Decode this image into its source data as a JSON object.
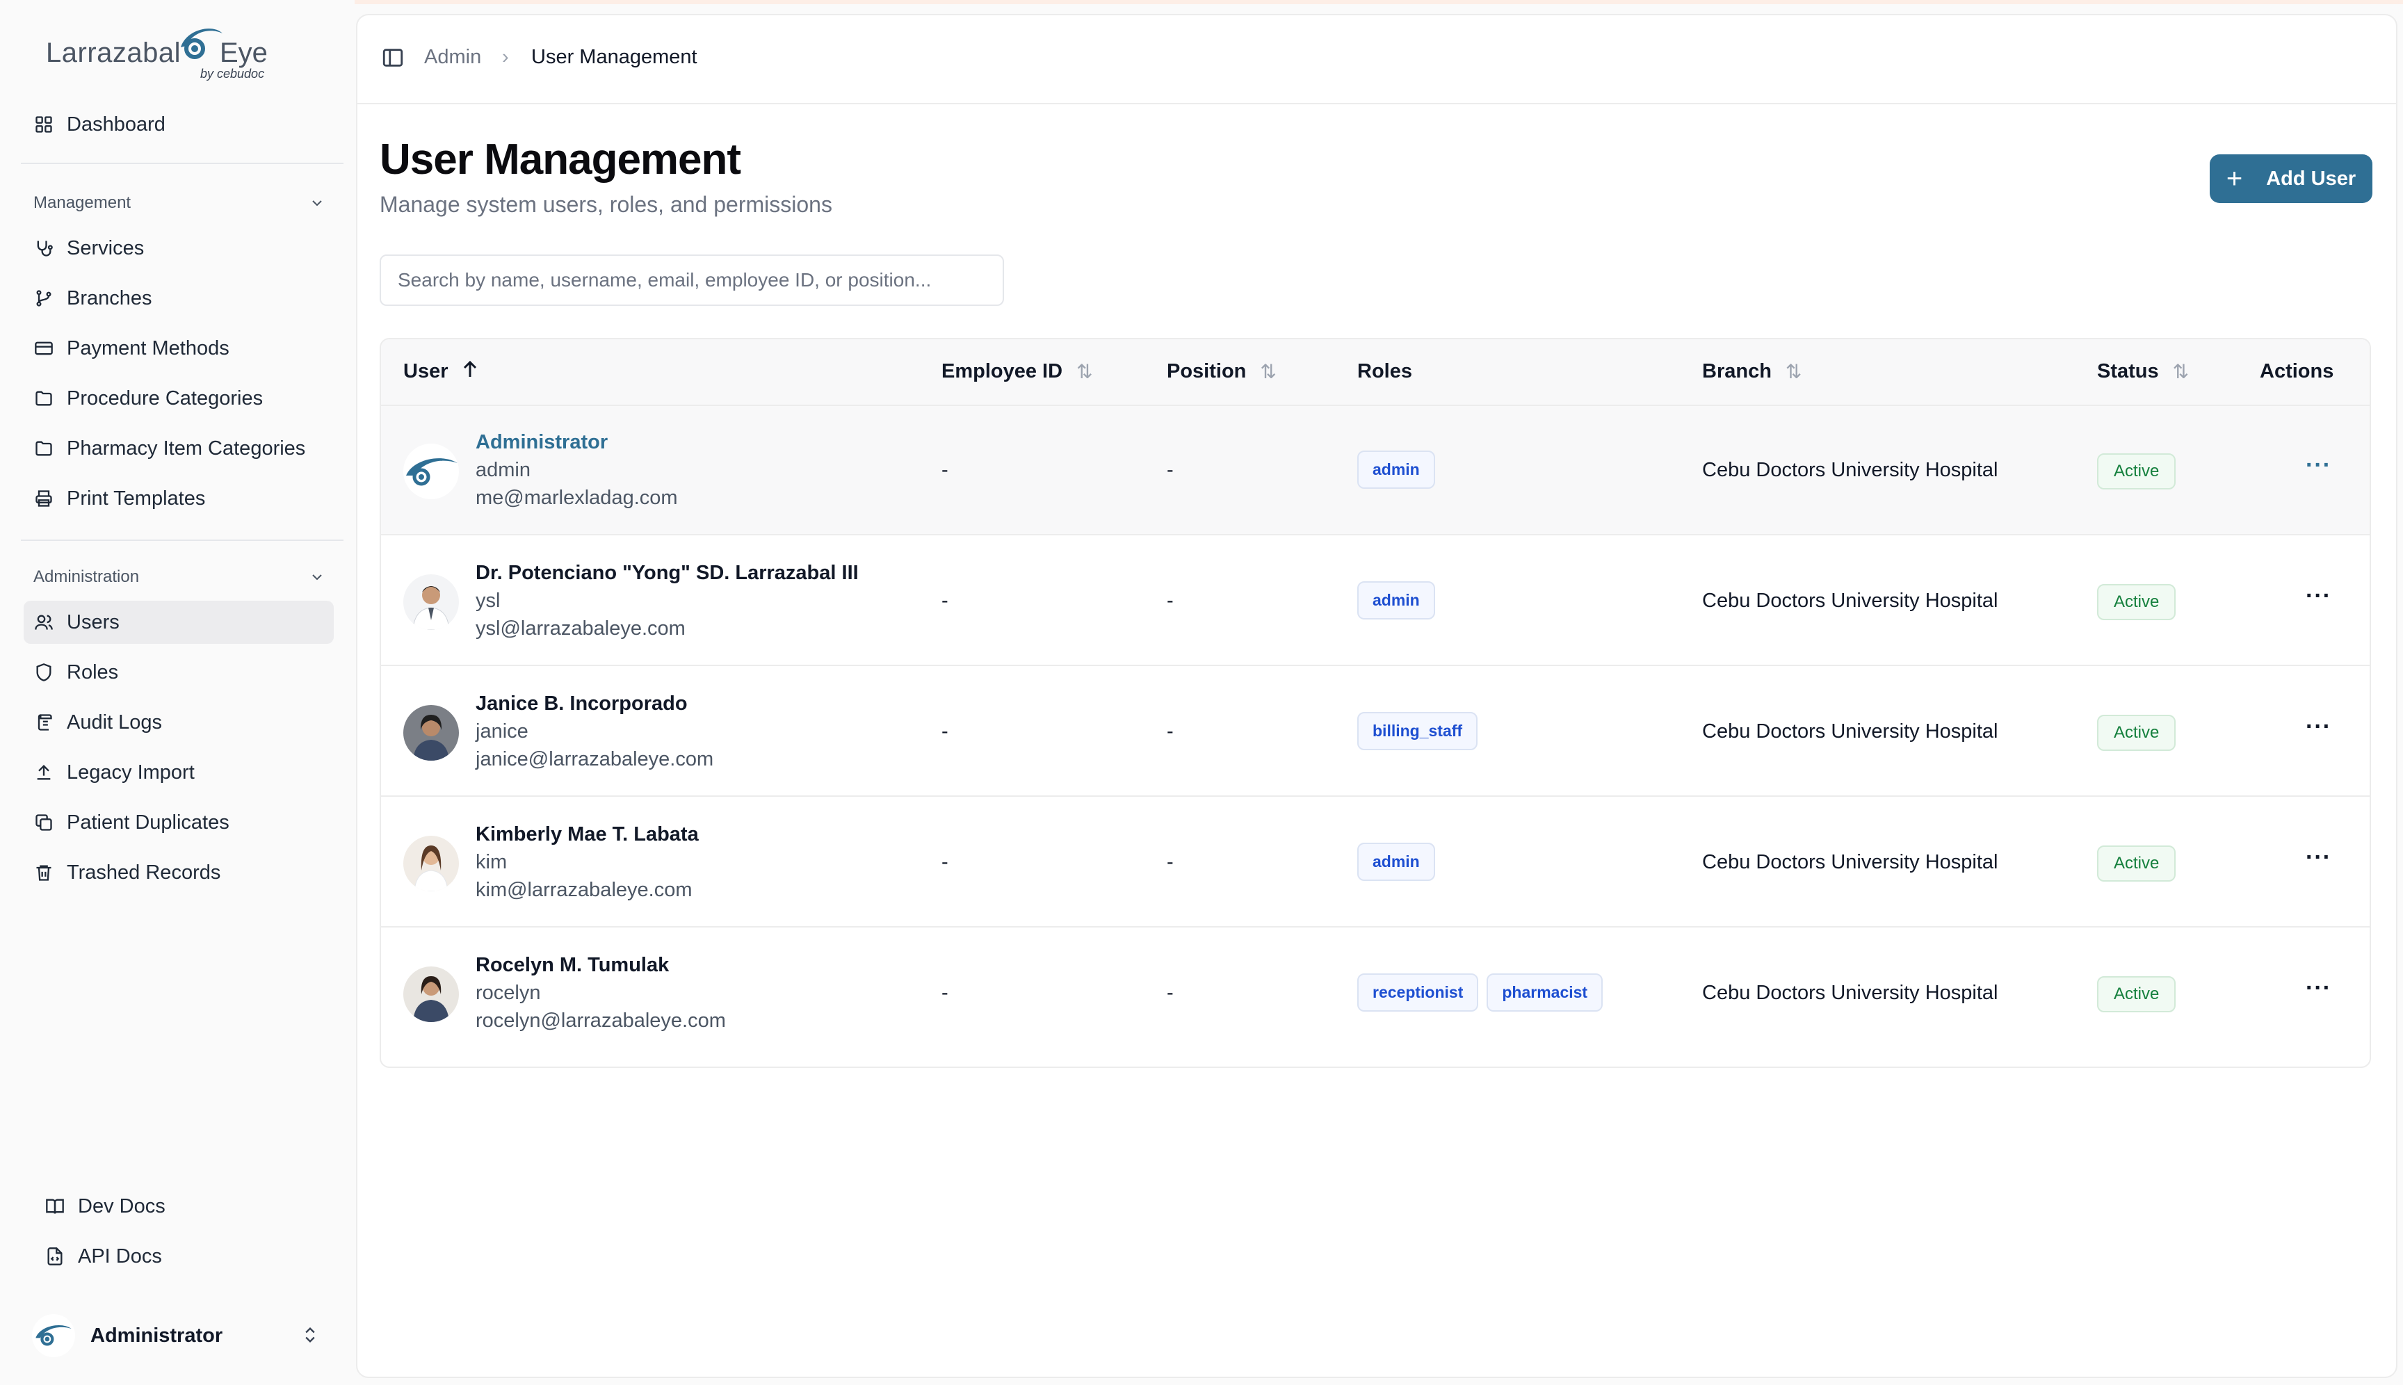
{
  "brand": {
    "name_left": "Larrazabal",
    "name_right": "Eye",
    "subtitle": "by cebudoc",
    "accent_color": "#2f6f94"
  },
  "sidebar": {
    "top_item": {
      "label": "Dashboard",
      "icon": "dashboard-grid-icon"
    },
    "sections": [
      {
        "label": "Management",
        "items": [
          {
            "label": "Services",
            "icon": "stethoscope-icon"
          },
          {
            "label": "Branches",
            "icon": "git-branch-icon"
          },
          {
            "label": "Payment Methods",
            "icon": "credit-card-icon"
          },
          {
            "label": "Procedure Categories",
            "icon": "folder-icon"
          },
          {
            "label": "Pharmacy Item Categories",
            "icon": "folder-icon"
          },
          {
            "label": "Print Templates",
            "icon": "printer-icon"
          }
        ]
      },
      {
        "label": "Administration",
        "items": [
          {
            "label": "Users",
            "icon": "users-icon",
            "active": true
          },
          {
            "label": "Roles",
            "icon": "shield-icon"
          },
          {
            "label": "Audit Logs",
            "icon": "scroll-icon"
          },
          {
            "label": "Legacy Import",
            "icon": "upload-icon"
          },
          {
            "label": "Patient Duplicates",
            "icon": "copy-icon"
          },
          {
            "label": "Trashed Records",
            "icon": "trash-icon"
          }
        ]
      }
    ],
    "footer_links": [
      {
        "label": "Dev Docs",
        "icon": "book-icon"
      },
      {
        "label": "API Docs",
        "icon": "file-code-icon"
      }
    ],
    "current_user": "Administrator"
  },
  "breadcrumb": {
    "parent": "Admin",
    "separator": "›",
    "current": "User Management"
  },
  "page": {
    "title": "User Management",
    "subtitle": "Manage system users, roles, and permissions",
    "add_button": "Add User",
    "search_placeholder": "Search by name, username, email, employee ID, or position..."
  },
  "table": {
    "headers": {
      "user": "User",
      "employee_id": "Employee ID",
      "position": "Position",
      "roles": "Roles",
      "branch": "Branch",
      "status": "Status",
      "actions": "Actions"
    },
    "rows": [
      {
        "name": "Administrator",
        "username": "admin",
        "email": "me@marlexladag.com",
        "employee_id": "-",
        "position": "-",
        "roles": [
          "admin"
        ],
        "branch": "Cebu Doctors University Hospital",
        "status": "Active",
        "actions": "···"
      },
      {
        "name": "Dr. Potenciano \"Yong\" SD. Larrazabal III",
        "username": "ysl",
        "email": "ysl@larrazabaleye.com",
        "employee_id": "-",
        "position": "-",
        "roles": [
          "admin"
        ],
        "branch": "Cebu Doctors University Hospital",
        "status": "Active",
        "actions": "···"
      },
      {
        "name": "Janice B. Incorporado",
        "username": "janice",
        "email": "janice@larrazabaleye.com",
        "employee_id": "-",
        "position": "-",
        "roles": [
          "billing_staff"
        ],
        "branch": "Cebu Doctors University Hospital",
        "status": "Active",
        "actions": "···"
      },
      {
        "name": "Kimberly Mae T. Labata",
        "username": "kim",
        "email": "kim@larrazabaleye.com",
        "employee_id": "-",
        "position": "-",
        "roles": [
          "admin"
        ],
        "branch": "Cebu Doctors University Hospital",
        "status": "Active",
        "actions": "···"
      },
      {
        "name": "Rocelyn M. Tumulak",
        "username": "rocelyn",
        "email": "rocelyn@larrazabaleye.com",
        "employee_id": "-",
        "position": "-",
        "roles": [
          "receptionist",
          "pharmacist"
        ],
        "branch": "Cebu Doctors University Hospital",
        "status": "Active",
        "actions": "···"
      }
    ]
  }
}
